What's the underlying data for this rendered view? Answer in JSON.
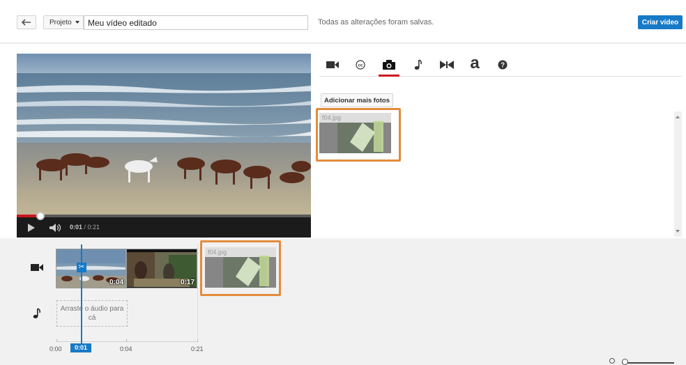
{
  "topbar": {
    "back_icon": "undo-arrow-icon",
    "project_label": "Projeto",
    "title_value": "Meu vídeo editado",
    "saved_status": "Todas as alterações foram salvas.",
    "create_label": "Criar vídeo"
  },
  "player": {
    "current_time": "0:01",
    "duration": " / 0:21",
    "progress": 0.08
  },
  "tabs": [
    {
      "icon": "video-camera-icon",
      "active": false
    },
    {
      "icon": "cc-icon",
      "active": false
    },
    {
      "icon": "camera-icon",
      "active": true
    },
    {
      "icon": "music-note-icon",
      "active": false
    },
    {
      "icon": "transition-icon",
      "active": false
    },
    {
      "icon": "text-icon",
      "label": "a",
      "active": false
    },
    {
      "icon": "help-icon",
      "active": false
    }
  ],
  "photos": {
    "add_label": "Adicionar mais fotos",
    "items": [
      {
        "name": "f04.jpg"
      }
    ]
  },
  "timeline": {
    "clips": [
      {
        "duration": "0:04"
      },
      {
        "duration": "0:17"
      },
      {
        "name": "f04.jpg"
      }
    ],
    "audio_placeholder": "Arraste o áudio para cá",
    "axis_labels": [
      "0:00",
      "0:04",
      "0:21"
    ],
    "playhead_time": "0:01"
  },
  "colors": {
    "accent_blue": "#167ac6",
    "accent_red": "#cc181e",
    "highlight_orange": "#e38b3c"
  }
}
